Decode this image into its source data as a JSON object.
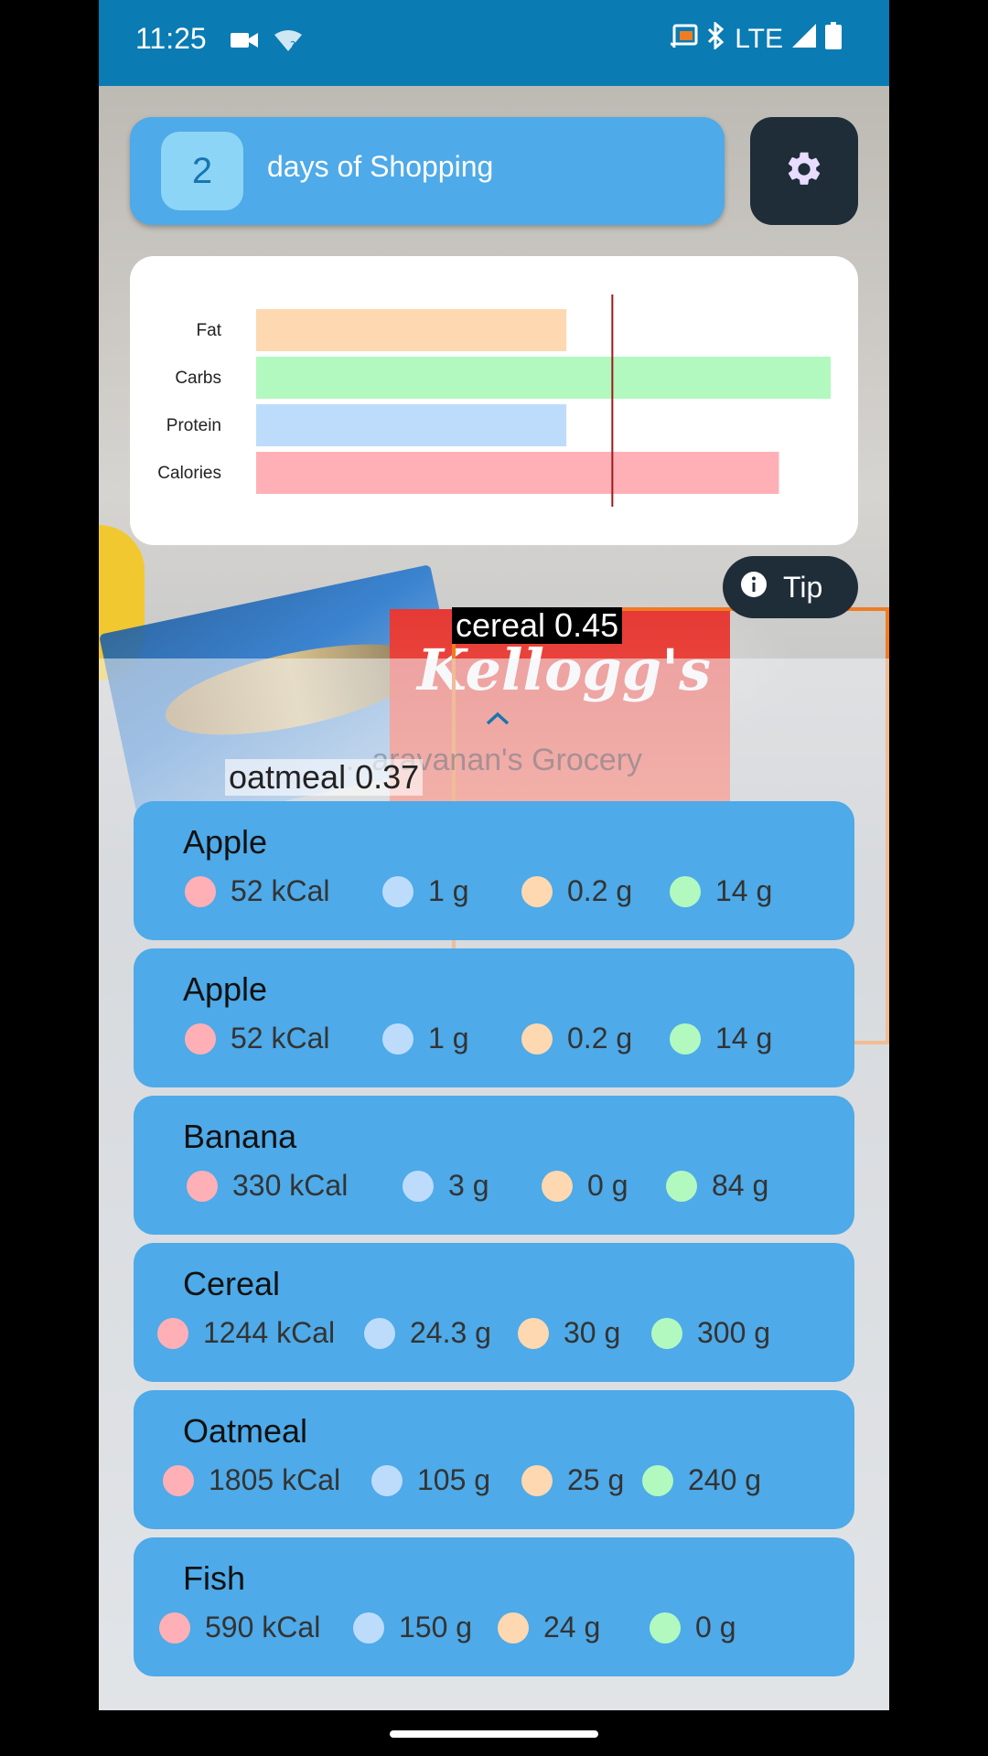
{
  "status_bar": {
    "time": "11:25",
    "network": "LTE",
    "left_icons": [
      "video-camera-icon",
      "wifi-unknown-icon"
    ],
    "right_icons": [
      "cast-icon",
      "bluetooth-icon",
      "signal-icon",
      "battery-icon"
    ]
  },
  "header": {
    "days_count": "2",
    "days_label": "days of Shopping"
  },
  "colors": {
    "accent": "#4eaae8",
    "dark_button": "#1f2d38",
    "calories": "#ffb0b6",
    "protein": "#bddcfb",
    "fat": "#fdd8b0",
    "carbs": "#b2f9c0",
    "target_line": "#9b1b1b"
  },
  "chart_data": {
    "type": "bar",
    "orientation": "horizontal",
    "categories": [
      "Fat",
      "Carbs",
      "Protein",
      "Calories"
    ],
    "values": [
      0.54,
      1.0,
      0.54,
      0.91
    ],
    "target_line": 0.62,
    "colors": [
      "#fdd8b0",
      "#b2f9c0",
      "#bddcfb",
      "#ffb0b6"
    ],
    "title": "",
    "xlabel": "",
    "ylabel": ""
  },
  "tip_label": "Tip",
  "detections": {
    "cereal": "cereal 0.45",
    "oatmeal": "oatmeal 0.37"
  },
  "sheet_title": "...aravanan's Grocery",
  "items": [
    {
      "name": "Apple",
      "calories": "52 kCal",
      "protein": "1 g",
      "fat": "0.2 g",
      "carbs": "14 g"
    },
    {
      "name": "Apple",
      "calories": "52 kCal",
      "protein": "1 g",
      "fat": "0.2 g",
      "carbs": "14 g"
    },
    {
      "name": "Banana",
      "calories": "330 kCal",
      "protein": "3 g",
      "fat": "0 g",
      "carbs": "84 g"
    },
    {
      "name": "Cereal",
      "calories": "1244 kCal",
      "protein": "24.3 g",
      "fat": "30 g",
      "carbs": "300 g"
    },
    {
      "name": "Oatmeal",
      "calories": "1805 kCal",
      "protein": "105 g",
      "fat": "25 g",
      "carbs": "240 g"
    },
    {
      "name": "Fish",
      "calories": "590 kCal",
      "protein": "150 g",
      "fat": "24 g",
      "carbs": "0 g"
    }
  ]
}
